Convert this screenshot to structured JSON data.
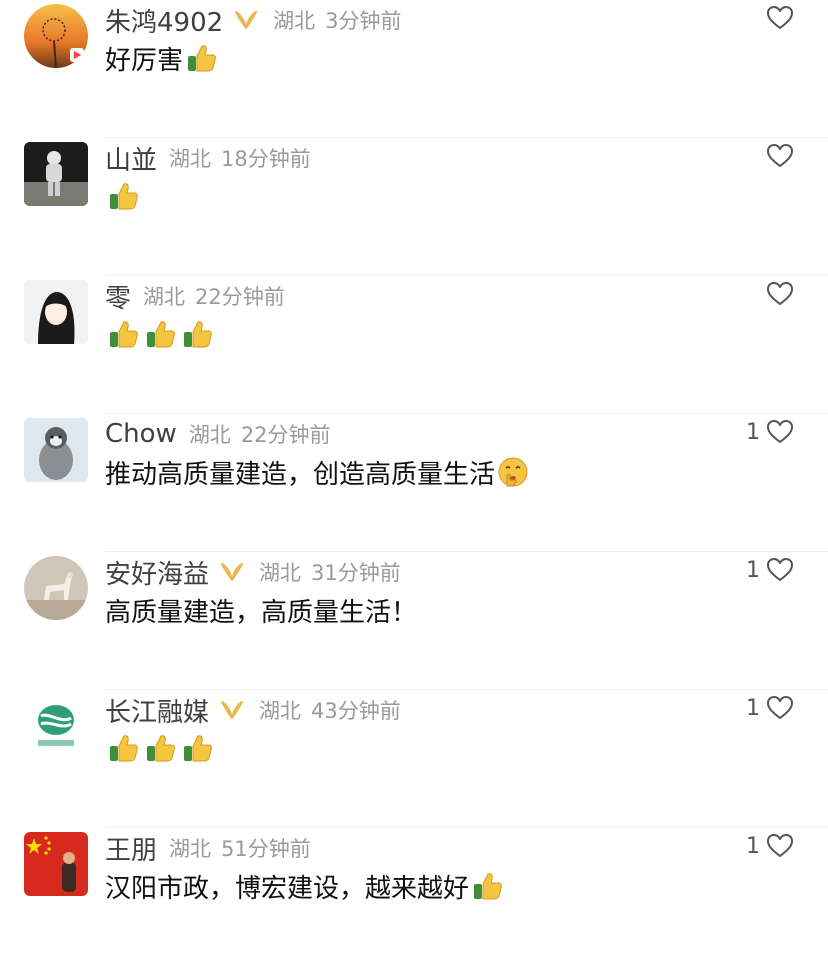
{
  "comments": [
    {
      "username": "朱鸿4902",
      "verified": true,
      "location": "湖北",
      "time": "3分钟前",
      "text": "好厉害",
      "emojis": [
        "thumbs-up"
      ],
      "likes": "",
      "avatar": "dandelion-sunset"
    },
    {
      "username": "山並",
      "verified": false,
      "location": "湖北",
      "time": "18分钟前",
      "text": "",
      "emojis": [
        "thumbs-up"
      ],
      "likes": "",
      "avatar": "astronaut-moon"
    },
    {
      "username": "零",
      "verified": false,
      "location": "湖北",
      "time": "22分钟前",
      "text": "",
      "emojis": [
        "thumbs-up",
        "thumbs-up",
        "thumbs-up"
      ],
      "likes": "",
      "avatar": "anime-girl"
    },
    {
      "username": "Chow",
      "verified": false,
      "location": "湖北",
      "time": "22分钟前",
      "text": "推动高质量建造，创造高质量生活",
      "emojis": [
        "shush-face"
      ],
      "likes": "1",
      "avatar": "penguin"
    },
    {
      "username": "安好海益",
      "verified": true,
      "location": "湖北",
      "time": "31分钟前",
      "text": "高质量建造，高质量生活！",
      "emojis": [],
      "likes": "1",
      "avatar": "deer-figure"
    },
    {
      "username": "长江融媒",
      "verified": true,
      "location": "湖北",
      "time": "43分钟前",
      "text": "",
      "emojis": [
        "thumbs-up",
        "thumbs-up",
        "thumbs-up"
      ],
      "likes": "1",
      "avatar": "changjiang-logo"
    },
    {
      "username": "王朋",
      "verified": false,
      "location": "湖北",
      "time": "51分钟前",
      "text": "汉阳市政，博宏建设，越来越好",
      "emojis": [
        "thumbs-up"
      ],
      "likes": "1",
      "avatar": "china-flag"
    }
  ],
  "colors": {
    "text": "#111111",
    "username": "#404040",
    "meta": "#9a9a9a",
    "badge": "#e8b84a",
    "divider": "#ececec"
  }
}
